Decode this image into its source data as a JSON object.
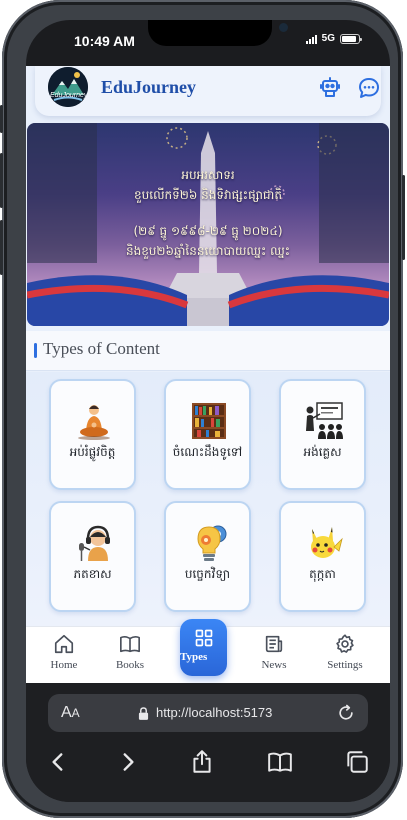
{
  "status_bar": {
    "time": "10:49 AM",
    "network": "5G",
    "battery_level": 0.9
  },
  "header": {
    "title": "EduJourney",
    "logo_text": "EduJourney"
  },
  "banner": {
    "line1": "អបអរសាទរ",
    "line2": "ខួបលើកទី២៦ និងទិវាផ្សះផ្សាជាតិ",
    "line3": "(២៩ ធ្នូ ១៩៩៨-២៩ ធ្នូ ២០២៤)",
    "line4": "និងខួប២៦ឆ្នាំនៃនយោបាយឈ្នះ ឈ្នះ"
  },
  "section": {
    "title": "Types of Content"
  },
  "content_types": [
    {
      "label": "អប់រំផ្លូវចិត្ត",
      "icon": "meditation-icon"
    },
    {
      "label": "ចំណេះដឹងទូទៅ",
      "icon": "bookshelf-icon"
    },
    {
      "label": "អង់គ្លេស",
      "icon": "english-class-icon"
    },
    {
      "label": "ភតខាស",
      "icon": "podcast-icon"
    },
    {
      "label": "បច្ចេកវិទ្យា",
      "icon": "technology-bulb-icon"
    },
    {
      "label": "តុក្កតា",
      "icon": "cartoon-character-icon"
    }
  ],
  "tabs": {
    "home": "Home",
    "books": "Books",
    "types": "Types",
    "news": "News",
    "settings": "Settings"
  },
  "browser": {
    "url": "http://localhost:5173",
    "aa_label": "A",
    "aa_small": "A"
  },
  "colors": {
    "accent": "#2e6fe0",
    "title": "#1f4ea8",
    "card_border": "#bcd5f2"
  }
}
